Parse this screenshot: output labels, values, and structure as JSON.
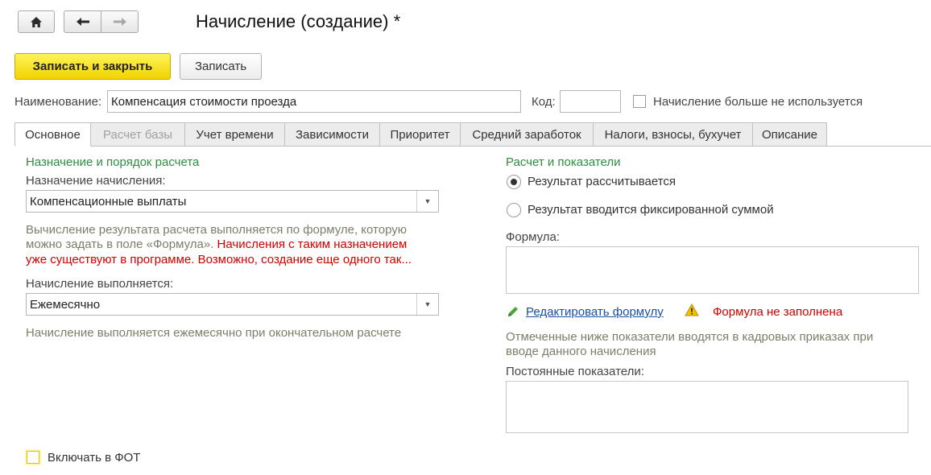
{
  "toolbar": {
    "home_icon": "home-icon",
    "back_icon": "arrow-left-icon",
    "forward_icon": "arrow-right-icon"
  },
  "window": {
    "title": "Начисление (создание) *"
  },
  "actions": {
    "save_close_label": "Записать и закрыть",
    "save_label": "Записать"
  },
  "header": {
    "name_label": "Наименование:",
    "name_value": "Компенсация стоимости проезда",
    "code_label": "Код:",
    "code_value": "",
    "unused_label": "Начисление больше не используется"
  },
  "tabs": [
    {
      "label": "Основное"
    },
    {
      "label": "Расчет базы"
    },
    {
      "label": "Учет времени"
    },
    {
      "label": "Зависимости"
    },
    {
      "label": "Приоритет"
    },
    {
      "label": "Средний заработок"
    },
    {
      "label": "Налоги, взносы, бухучет"
    },
    {
      "label": "Описание"
    }
  ],
  "left": {
    "section_title": "Назначение и порядок расчета",
    "purpose_label": "Назначение начисления:",
    "purpose_value": "Компенсационные выплаты",
    "info_gray_1": "Вычисление результата расчета выполняется по формуле, которую",
    "info_gray_2": "можно задать в поле «Формула».",
    "info_red_2": "Начисления с таким назначением",
    "info_red_3": "уже существуют в программе. Возможно, создание еще одного так...",
    "execute_label": "Начисление выполняется:",
    "execute_value": "Ежемесячно",
    "execute_hint": "Начисление выполняется ежемесячно при окончательном расчете",
    "fot_label": "Включать в ФОТ"
  },
  "right": {
    "section_title": "Расчет и показатели",
    "radio_calc": "Результат рассчитывается",
    "radio_fixed": "Результат вводится фиксированной суммой",
    "formula_label": "Формула:",
    "formula_value": "",
    "edit_formula_link": "Редактировать формулу",
    "formula_warning": "Формула не заполнена",
    "indicators_note_1": "Отмеченные ниже показатели вводятся в кадровых приказах при",
    "indicators_note_2": "вводе данного начисления",
    "constant_label": "Постоянные показатели:"
  },
  "colors": {
    "primary_button": "#f5dc17",
    "section_green": "#2d8f3f",
    "warning_red": "#d00000",
    "link_blue": "#1a4fa3"
  }
}
